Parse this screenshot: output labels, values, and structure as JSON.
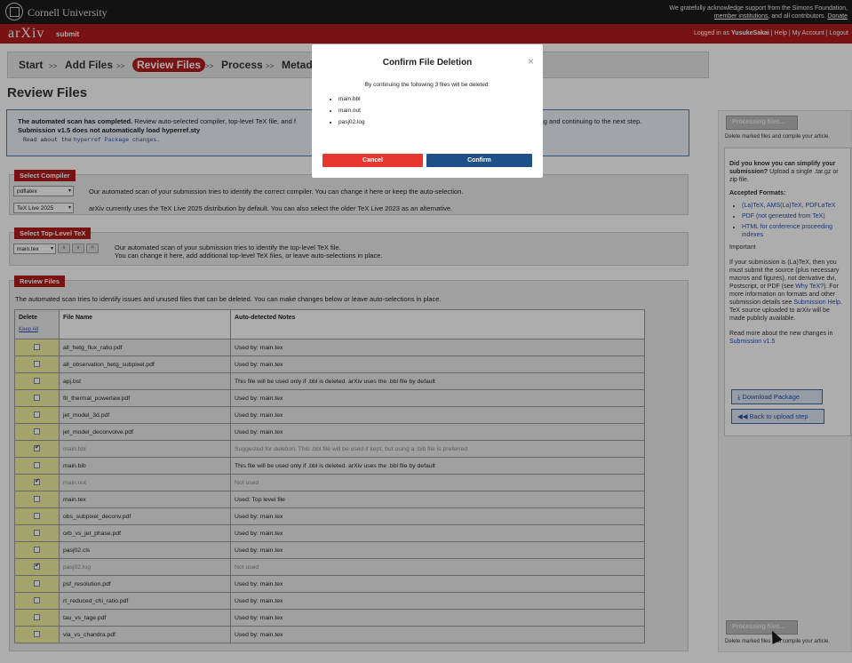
{
  "header": {
    "institution": "Cornell University",
    "ack_line1": "We gratefully acknowledge support from the Simons Foundation,",
    "ack_link1": "member institutions",
    "ack_mid": ", and all contributors.",
    "ack_link2": "Donate"
  },
  "arxiv_bar": {
    "logo": "arXiv",
    "section": "submit",
    "logged_in_prefix": "Logged in as",
    "username": "YusukeSakai",
    "help": "Help",
    "account": "My Account",
    "logout": "Logout"
  },
  "steps": {
    "start": "Start",
    "add_files": "Add Files",
    "review_files": "Review Files",
    "process": "Process",
    "metadata": "Metad",
    "sep": ">>"
  },
  "page_title": "Review Files",
  "scan_box": {
    "bold": "The automated scan has completed.",
    "text": " Review auto-selected compiler, top-level TeX file, and f",
    "text_right": "ccepting and continuing to the next step.",
    "line2": "Submission v1.5 does not automatically load hyperref.sty",
    "line3_prefix": "Read about the",
    "line3_link": "hyperref Package changes."
  },
  "compiler": {
    "label": "Select Compiler",
    "compiler_value": "pdflatex",
    "compiler_note": "Our automated scan of your submission tries to identify the correct compiler. You can change it here or keep the auto-selection.",
    "texlive_value": "TeX Live 2025",
    "texlive_note": "arXiv currently uses the TeX Live 2025 distribution by default. You can also select the older TeX Live 2023 as an alternative."
  },
  "toplevel": {
    "label": "Select Top-Level TeX",
    "value": "main.tex",
    "note1": "Our automated scan of your submission tries to identify the top-level TeX file.",
    "note2": "You can change it here, add additional top-level TeX files, or leave auto-selections in place."
  },
  "review": {
    "label": "Review Files",
    "intro": "The automated scan tries to identify issues and unused files that can be deleted. You can make changes below or leave auto-selections in place.",
    "col_delete": "Delete",
    "keep_all": "Keep All",
    "col_file": "File Name",
    "col_notes": "Auto-detected Notes",
    "rows": [
      {
        "file": "all_hetg_flux_ratio.pdf",
        "note": "Used by: main.tex",
        "checked": false,
        "dim": false
      },
      {
        "file": "all_observation_hetg_subpixel.pdf",
        "note": "Used by: main.tex",
        "checked": false,
        "dim": false
      },
      {
        "file": "apj.bst",
        "note": "This file will be used only if .bbl is deleted. arXiv uses the .bbl file by default",
        "checked": false,
        "dim": false
      },
      {
        "file": "fit_thermal_powerlaw.pdf",
        "note": "Used by: main.tex",
        "checked": false,
        "dim": false
      },
      {
        "file": "jet_model_3d.pdf",
        "note": "Used by: main.tex",
        "checked": false,
        "dim": false
      },
      {
        "file": "jet_model_deconvolve.pdf",
        "note": "Used by: main.tex",
        "checked": false,
        "dim": false
      },
      {
        "file": "main.bbl",
        "note": "Suggested for deletion. This .bbl file will be used if kept, but using a .bib file is preferred",
        "checked": true,
        "dim": true
      },
      {
        "file": "main.bib",
        "note": "This file will be used only if .bbl is deleted. arXiv uses the .bbl file by default",
        "checked": false,
        "dim": false
      },
      {
        "file": "main.out",
        "note": "Not used",
        "checked": true,
        "dim": true
      },
      {
        "file": "main.tex",
        "note": "Used: Top level file",
        "checked": false,
        "dim": false
      },
      {
        "file": "obs_subpixel_deconv.pdf",
        "note": "Used by: main.tex",
        "checked": false,
        "dim": false
      },
      {
        "file": "orb_vs_jet_phase.pdf",
        "note": "Used by: main.tex",
        "checked": false,
        "dim": false
      },
      {
        "file": "pasj02.cls",
        "note": "Used by: main.tex",
        "checked": false,
        "dim": false
      },
      {
        "file": "pasj02.log",
        "note": "Not used",
        "checked": true,
        "dim": true
      },
      {
        "file": "psf_resolution.pdf",
        "note": "Used by: main.tex",
        "checked": false,
        "dim": false
      },
      {
        "file": "rt_reduced_chi_ratio.pdf",
        "note": "Used by: main.tex",
        "checked": false,
        "dim": false
      },
      {
        "file": "tau_vs_tage.pdf",
        "note": "Used by: main.tex",
        "checked": false,
        "dim": false
      },
      {
        "file": "vla_vs_chandra.pdf",
        "note": "Used by: main.tex",
        "checked": false,
        "dim": false
      }
    ]
  },
  "right_panel": {
    "process_button": "Processing files...",
    "process_hint": "Delete marked files and compile your article.",
    "tip_q": "Did you know you can simplify your submission?",
    "tip_a": " Upload a single .tar.gz or zip file.",
    "formats_title": "Accepted Formats:",
    "format1": "(La)TeX, AMS(La)TeX, PDFLaTeX",
    "format2": "PDF (not generated from TeX)",
    "format3": "HTML for conference proceeding indexes",
    "important": "Important",
    "important_text": "If your submission is (La)TeX, then you must submit the source (plus necessary macros and figures), not derivative dvi, Postscript, or PDF (see ",
    "why_tex": "Why TeX?",
    "important_text2": "). For more information on formats and other submission details see ",
    "sub_help": "Submission Help",
    "important_text3": ". TeX source uploaded to arXiv will be made publicly available.",
    "readmore": "Read more about the new changes in ",
    "sub_v15": "Submission v1.5",
    "download": "Download Package",
    "back": "Back to upload step",
    "process_button2": "Processing files...",
    "process_hint2": "Delete marked files and compile your article."
  },
  "modal": {
    "title": "Confirm File Deletion",
    "close": "×",
    "body": "By continuing the following 3 files will be deleted:",
    "files": [
      "main.bbl",
      "main.out",
      "pasj02.log"
    ],
    "cancel": "Cancel",
    "confirm": "Confirm",
    "cancel_color": "#e8372e",
    "confirm_color": "#1e4f86"
  }
}
